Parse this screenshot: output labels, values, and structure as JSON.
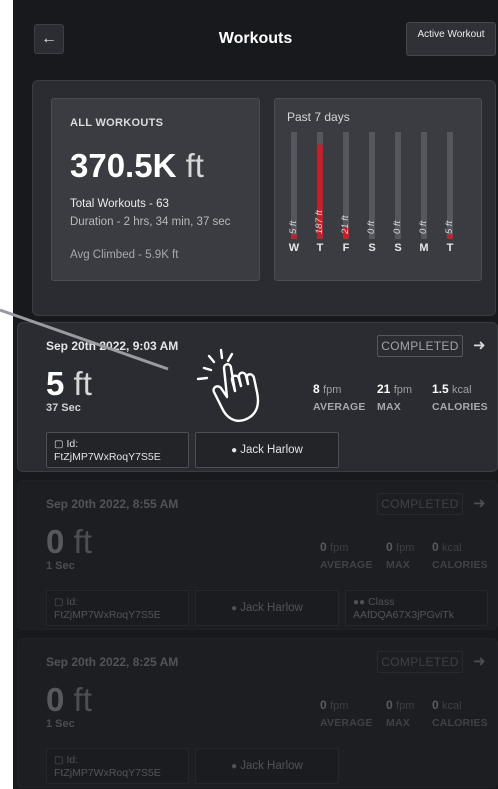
{
  "header": {
    "title": "Workouts",
    "back_icon": "arrow-left-icon",
    "active_button": "Active Workout"
  },
  "summary": {
    "all_label": "ALL WORKOUTS",
    "total_value": "370.5K",
    "total_unit": "ft",
    "total_workouts": "Total Workouts - 63",
    "duration": "Duration - 2 hrs, 34 min, 37 sec",
    "avg_climbed": "Avg Climbed - 5.9K ft"
  },
  "week": {
    "title": "Past 7 days",
    "days": [
      {
        "day": "W",
        "label": "5 ft",
        "value": 5
      },
      {
        "day": "T",
        "label": "187 ft",
        "value": 187
      },
      {
        "day": "F",
        "label": "21 ft",
        "value": 21
      },
      {
        "day": "S",
        "label": "0 ft",
        "value": 0
      },
      {
        "day": "S",
        "label": "0 ft",
        "value": 0
      },
      {
        "day": "M",
        "label": "0 ft",
        "value": 0
      },
      {
        "day": "T",
        "label": "5 ft",
        "value": 5
      }
    ],
    "bar_color": "#c4202a"
  },
  "workouts": [
    {
      "date": "Sep 20th 2022, 9:03 AM",
      "status": "COMPLETED",
      "feet": "5",
      "feet_unit": "ft",
      "seconds": "37 Sec",
      "avg_val": "8",
      "avg_unit": "fpm",
      "avg_label": "AVERAGE",
      "max_val": "21",
      "max_unit": "fpm",
      "max_label": "MAX",
      "cal_val": "1.5",
      "cal_unit": "kcal",
      "cal_label": "CALORIES",
      "id_label": "Id:",
      "id_value": "FtZjMP7WxRoqY7S5E",
      "user": "Jack Harlow"
    },
    {
      "date": "Sep 20th 2022, 8:55 AM",
      "status": "COMPLETED",
      "feet": "0",
      "feet_unit": "ft",
      "seconds": "1 Sec",
      "avg_val": "0",
      "avg_unit": "fpm",
      "avg_label": "AVERAGE",
      "max_val": "0",
      "max_unit": "fpm",
      "max_label": "MAX",
      "cal_val": "0",
      "cal_unit": "kcal",
      "cal_label": "CALORIES",
      "id_label": "Id:",
      "id_value": "FtZjMP7WxRoqY7S5E",
      "user": "Jack Harlow",
      "class_label": "Class",
      "class_value": "AAfDQA67X3jPGviTk"
    },
    {
      "date": "Sep 20th 2022, 8:25 AM",
      "status": "COMPLETED",
      "feet": "0",
      "feet_unit": "ft",
      "seconds": "1 Sec",
      "avg_val": "0",
      "avg_unit": "fpm",
      "avg_label": "AVERAGE",
      "max_val": "0",
      "max_unit": "fpm",
      "max_label": "MAX",
      "cal_val": "0",
      "cal_unit": "kcal",
      "cal_label": "CALORIES",
      "id_label": "Id:",
      "id_value": "FtZjMP7WxRoqY7S5E",
      "user": "Jack Harlow"
    }
  ],
  "icons": {
    "arrow": "arrow-right-icon",
    "device": "device-icon",
    "user": "user-icon",
    "class": "group-icon",
    "gesture": "tap-hand-icon"
  }
}
